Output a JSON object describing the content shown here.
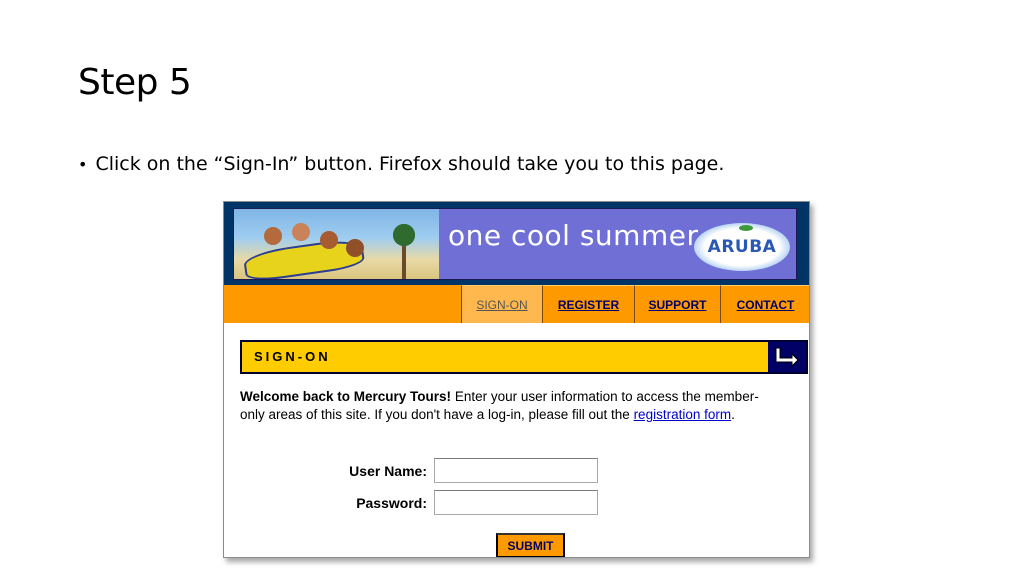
{
  "slide": {
    "title": "Step 5",
    "bullet": "Click on the “Sign-In” button. Firefox should take you to this page."
  },
  "screenshot": {
    "banner": {
      "tagline": "one cool summer",
      "logo_text": "ARUBA"
    },
    "nav": {
      "tabs": [
        {
          "label": "SIGN-ON",
          "active": true
        },
        {
          "label": "REGISTER",
          "active": false
        },
        {
          "label": "SUPPORT",
          "active": false
        },
        {
          "label": "CONTACT",
          "active": false
        }
      ]
    },
    "section": {
      "title": "SIGN-ON",
      "icon": "sign-on-arrow-icon"
    },
    "welcome": {
      "bold": "Welcome back to Mercury Tours!",
      "text": " Enter your user information to access the member-only areas of this site. If you don't have a log-in, please fill out the ",
      "link": "registration form",
      "end": "."
    },
    "form": {
      "username_label": "User Name:",
      "username_value": "",
      "password_label": "Password:",
      "password_value": "",
      "submit_label": "SUBMIT"
    },
    "colors": {
      "nav_orange": "#ff9900",
      "section_yellow": "#ffcc00",
      "banner_purple": "#6f6fd6",
      "dark_navy": "#003366"
    }
  }
}
